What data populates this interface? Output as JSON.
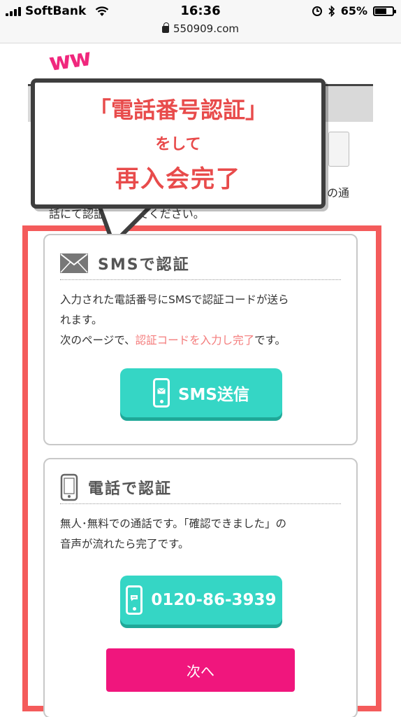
{
  "status_bar": {
    "carrier": "SoftBank",
    "time": "16:36",
    "battery_percent": "65%",
    "battery_level": 0.65,
    "url": "550909.com"
  },
  "background_page": {
    "decoration": "ww",
    "text_right": "の通",
    "text_left": "話にて認証を行ってください。"
  },
  "callout": {
    "line1": "「電話番号認証」",
    "line2": "をして",
    "line3": "再入会完了",
    "text_color": "#e84b4b"
  },
  "sms_card": {
    "title": "SMSで認証",
    "text_line1": "入力された電話番号にSMSで認証コードが送ら",
    "text_line2": "れます。",
    "text_line3_pre": "次のページで、",
    "text_line3_highlight": "認証コードを入力し完了",
    "text_line3_post": "です。",
    "button_label": "SMS送信"
  },
  "tel_card": {
    "title": "電話で認証",
    "text_line1": "無人･無料での通話です。「確認できました」の",
    "text_line2": "音声が流れたら完了です。",
    "button_label": "0120-86-3939",
    "next_label": "次へ"
  },
  "colors": {
    "frame": "#f45b5b",
    "teal": "#35d6c5",
    "pink_button": "#f0167d"
  },
  "icons": [
    "signal-icon",
    "wifi-icon",
    "lock-icon",
    "alarm-icon",
    "bluetooth-icon",
    "battery-icon",
    "mail-icon",
    "smartphone-icon"
  ]
}
